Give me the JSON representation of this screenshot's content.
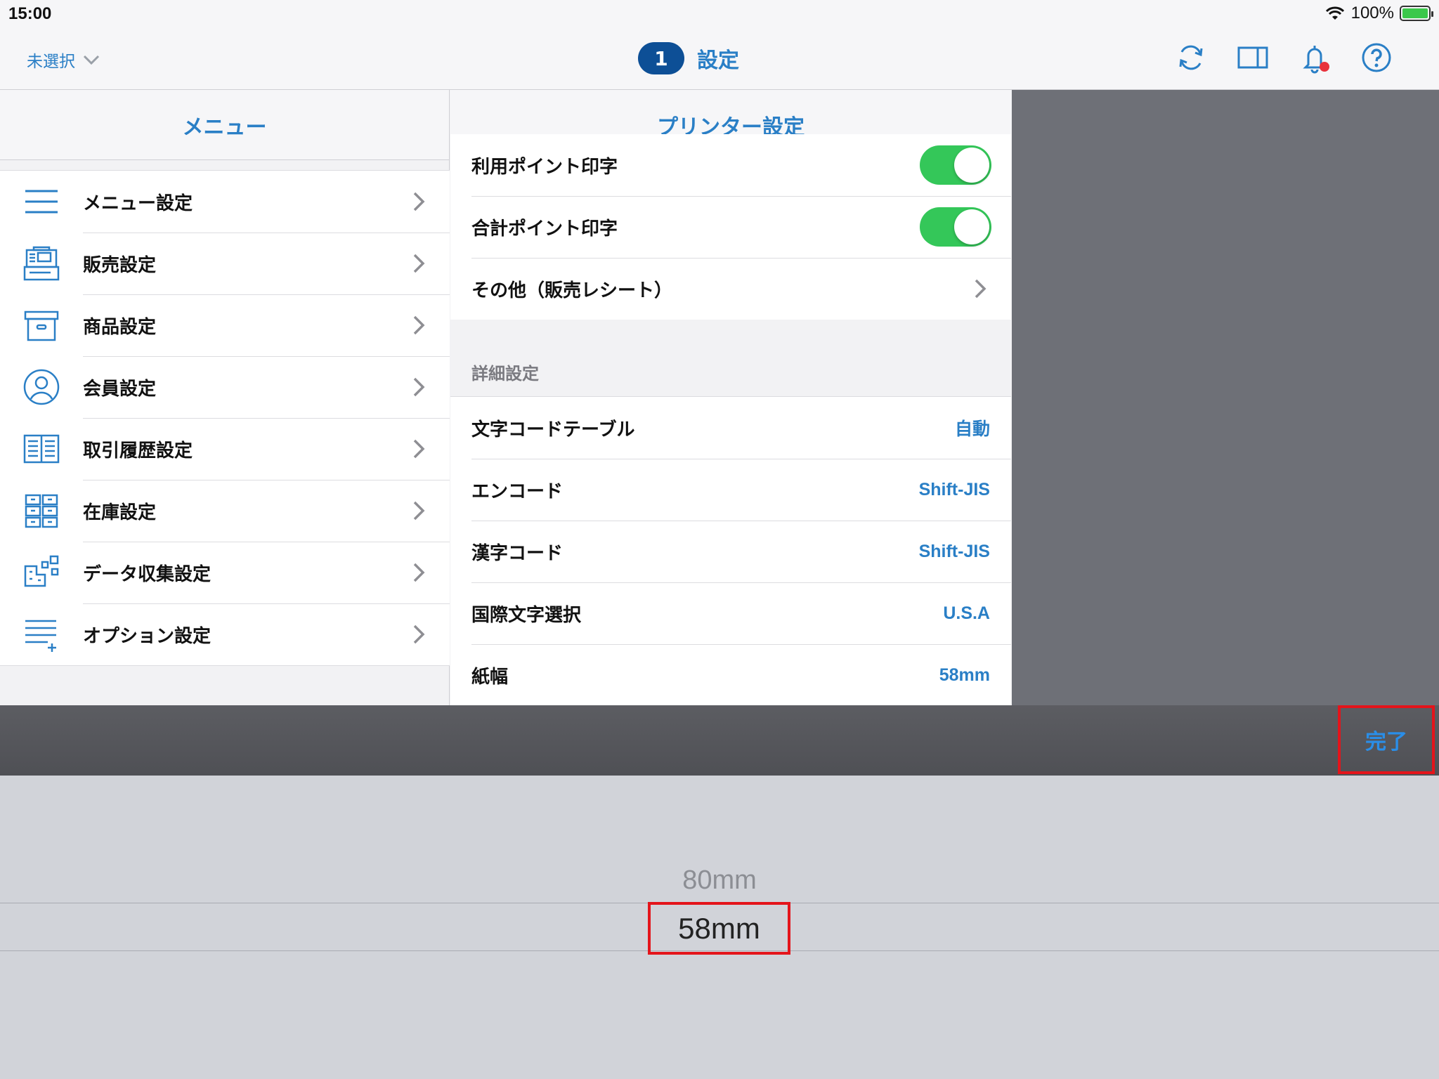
{
  "status_bar": {
    "time": "15:00",
    "battery": "100%"
  },
  "nav": {
    "store_selector": "未選択",
    "badge_count": "1",
    "title": "設定"
  },
  "left_panel": {
    "title": "メニュー",
    "items": [
      {
        "label": "メニュー設定",
        "icon": "menu-lines-icon"
      },
      {
        "label": "販売設定",
        "icon": "register-icon"
      },
      {
        "label": "商品設定",
        "icon": "box-icon"
      },
      {
        "label": "会員設定",
        "icon": "person-icon"
      },
      {
        "label": "取引履歴設定",
        "icon": "ledger-icon"
      },
      {
        "label": "在庫設定",
        "icon": "shelves-icon"
      },
      {
        "label": "データ収集設定",
        "icon": "data-collect-icon"
      },
      {
        "label": "オプション設定",
        "icon": "options-list-icon"
      }
    ]
  },
  "right_panel": {
    "title": "プリンター設定",
    "receipt_rows": [
      {
        "label": "利用ポイント印字",
        "toggle": true
      },
      {
        "label": "合計ポイント印字",
        "toggle": true
      },
      {
        "label": "その他（販売レシート）",
        "chevron": true
      }
    ],
    "detail_header": "詳細設定",
    "detail_rows": [
      {
        "label": "文字コードテーブル",
        "value": "自動"
      },
      {
        "label": "エンコード",
        "value": "Shift-JIS"
      },
      {
        "label": "漢字コード",
        "value": "Shift-JIS"
      },
      {
        "label": "国際文字選択",
        "value": "U.S.A"
      },
      {
        "label": "紙幅",
        "value": "58mm"
      }
    ]
  },
  "picker": {
    "done_label": "完了",
    "options": [
      "80mm",
      "58mm"
    ],
    "selected": "58mm"
  },
  "colors": {
    "accent": "#2a7fc6",
    "badge": "#0d4f96",
    "toggle_on": "#34c759",
    "highlight": "#e4141b"
  }
}
